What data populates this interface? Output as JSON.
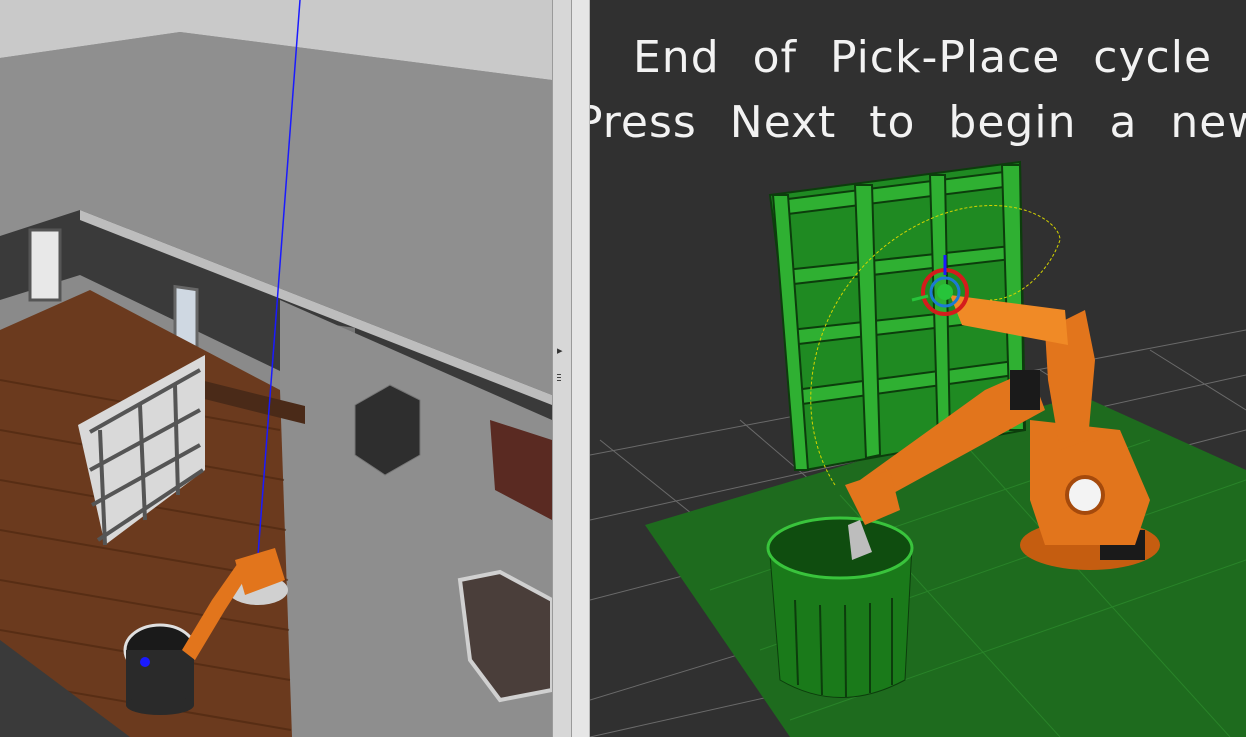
{
  "rviz_overlay": {
    "line_1": "End of Pick-Place cycle",
    "line_2": "Press Next to begin a new"
  },
  "splitter": {
    "arrow_icon": "triangle-right",
    "grip_icon": "vertical-grip"
  },
  "colors": {
    "robot_orange": "#e2751c",
    "shelf_green": "#1f8a22",
    "floor_green": "#1e6b1e",
    "grid_line": "#6a6a6a",
    "wood_floor": "#6b3a1e",
    "marker_blue": "#1a1aff"
  }
}
